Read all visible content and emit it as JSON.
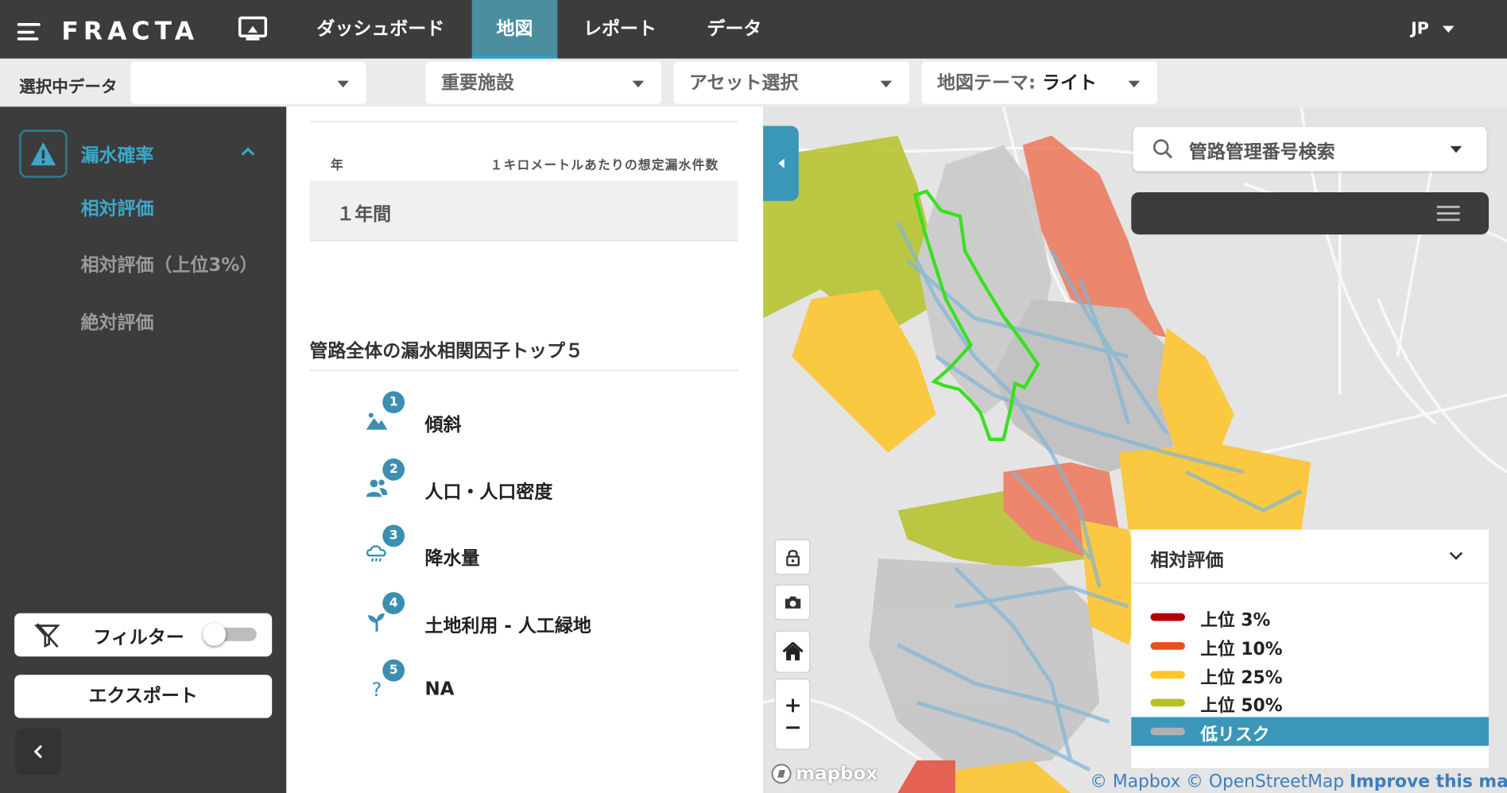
{
  "app": {
    "logo": "FRACTA"
  },
  "nav": {
    "tabs": [
      {
        "label": "ダッシュボード"
      },
      {
        "label": "地図"
      },
      {
        "label": "レポート"
      },
      {
        "label": "データ"
      }
    ],
    "language": "JP"
  },
  "filterbar": {
    "selected_data_label": "選択中データ",
    "selected_data_value": "",
    "facilities": "重要施設",
    "assets": "アセット選択",
    "theme_label": "地図テーマ: ",
    "theme_value": "ライト"
  },
  "sidebar": {
    "section": "漏水確率",
    "items": [
      {
        "label": "相対評価"
      },
      {
        "label": "相対評価（上位3%）"
      },
      {
        "label": "絶対評価"
      }
    ],
    "filter_label": "フィルター",
    "filter_on": false,
    "export_label": "エクスポート"
  },
  "panel": {
    "col_year": "年",
    "col_leak": "１キロメートルあたりの想定漏水件数",
    "row_year": "１年間",
    "row_value": "",
    "top5_title": "管路全体の漏水相関因子トップ５",
    "factors": [
      {
        "rank": "1",
        "label": "傾斜",
        "icon": "slope-icon"
      },
      {
        "rank": "2",
        "label": "人口・人口密度",
        "icon": "population-icon"
      },
      {
        "rank": "3",
        "label": "降水量",
        "icon": "rain-icon"
      },
      {
        "rank": "4",
        "label": "土地利用 - 人工緑地",
        "icon": "plant-icon"
      },
      {
        "rank": "5",
        "label": "NA",
        "icon": "question-icon"
      }
    ]
  },
  "map": {
    "search_placeholder": "管路管理番号検索",
    "legend_title": "相対評価",
    "legend": [
      {
        "label": "上位 3%",
        "color": "#b30000"
      },
      {
        "label": "上位 10%",
        "color": "#e8501f"
      },
      {
        "label": "上位 25%",
        "color": "#ffc425"
      },
      {
        "label": "上位 50%",
        "color": "#b5c227"
      },
      {
        "label": "低リスク",
        "color": "#b0b0b0"
      }
    ],
    "mapbox_logo": "mapbox",
    "attribution_1": "© Mapbox",
    "attribution_2": "© OpenStreetMap",
    "attribution_3": "Improve this map"
  },
  "colors": {
    "accent": "#3b97b8",
    "dark": "#3c3c3c",
    "highlight": "#39e01f"
  }
}
